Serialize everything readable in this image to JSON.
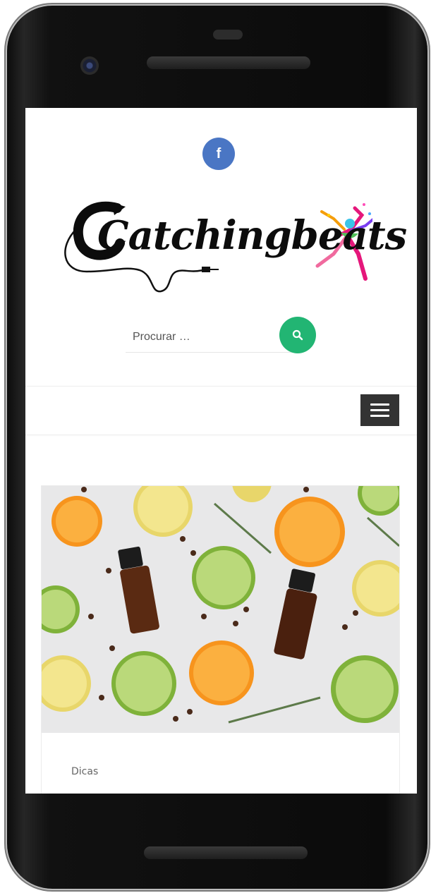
{
  "header": {
    "social": {
      "icon": "facebook-icon",
      "label": "f",
      "color": "#4a76c4"
    },
    "logo": {
      "text": "Catchingbeats"
    }
  },
  "search": {
    "placeholder": "Procurar …",
    "value": "",
    "icon": "search-icon",
    "button_color": "#22b573"
  },
  "nav": {
    "menu_icon": "hamburger-menu-icon"
  },
  "post": {
    "image_alt": "essential-oil-bottles-with-citrus-slices",
    "category": "Dicas"
  },
  "colors": {
    "accent": "#22b573",
    "facebook": "#4a76c4",
    "menu": "#333333"
  }
}
